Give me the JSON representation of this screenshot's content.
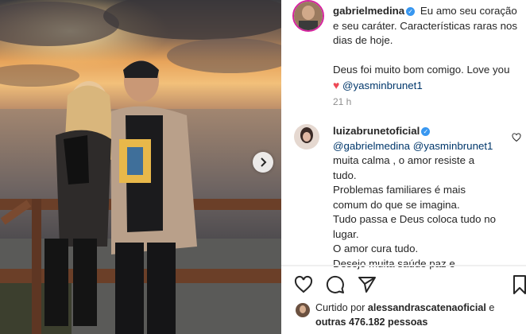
{
  "post": {
    "author": "gabrielmedina",
    "caption_lines": [
      "Eu amo seu coração",
      "e seu caráter. Características raras nos",
      "dias de hoje."
    ],
    "caption_line2": "Deus foi muito bom comigo. Love you",
    "caption_mention": "@yasminbrunet1",
    "time": "21 h"
  },
  "comment": {
    "author": "luizabrunetoficial",
    "mention1": "@gabrielmedina",
    "mention2": "@yasminbrunet1",
    "lines": [
      "muita calma , o amor resiste a",
      "tudo.",
      "Problemas familiares é mais",
      "comum do que se imagina.",
      "Tudo passa e Deus coloca tudo no",
      "lugar.",
      "O amor cura tudo.",
      "Desejo muita saúde paz e"
    ]
  },
  "likes": {
    "prefix": "Curtido por",
    "user": "alessandrascatenaoficial",
    "conj": "e",
    "others": "outras 476.182 pessoas"
  },
  "icons": [
    "heart-icon",
    "comment-icon",
    "share-icon",
    "bookmark-icon",
    "chevron-right-icon",
    "verified-icon"
  ],
  "colors": {
    "verified": "#3897f0",
    "mention": "#00376b",
    "heart": "#ed4956"
  }
}
